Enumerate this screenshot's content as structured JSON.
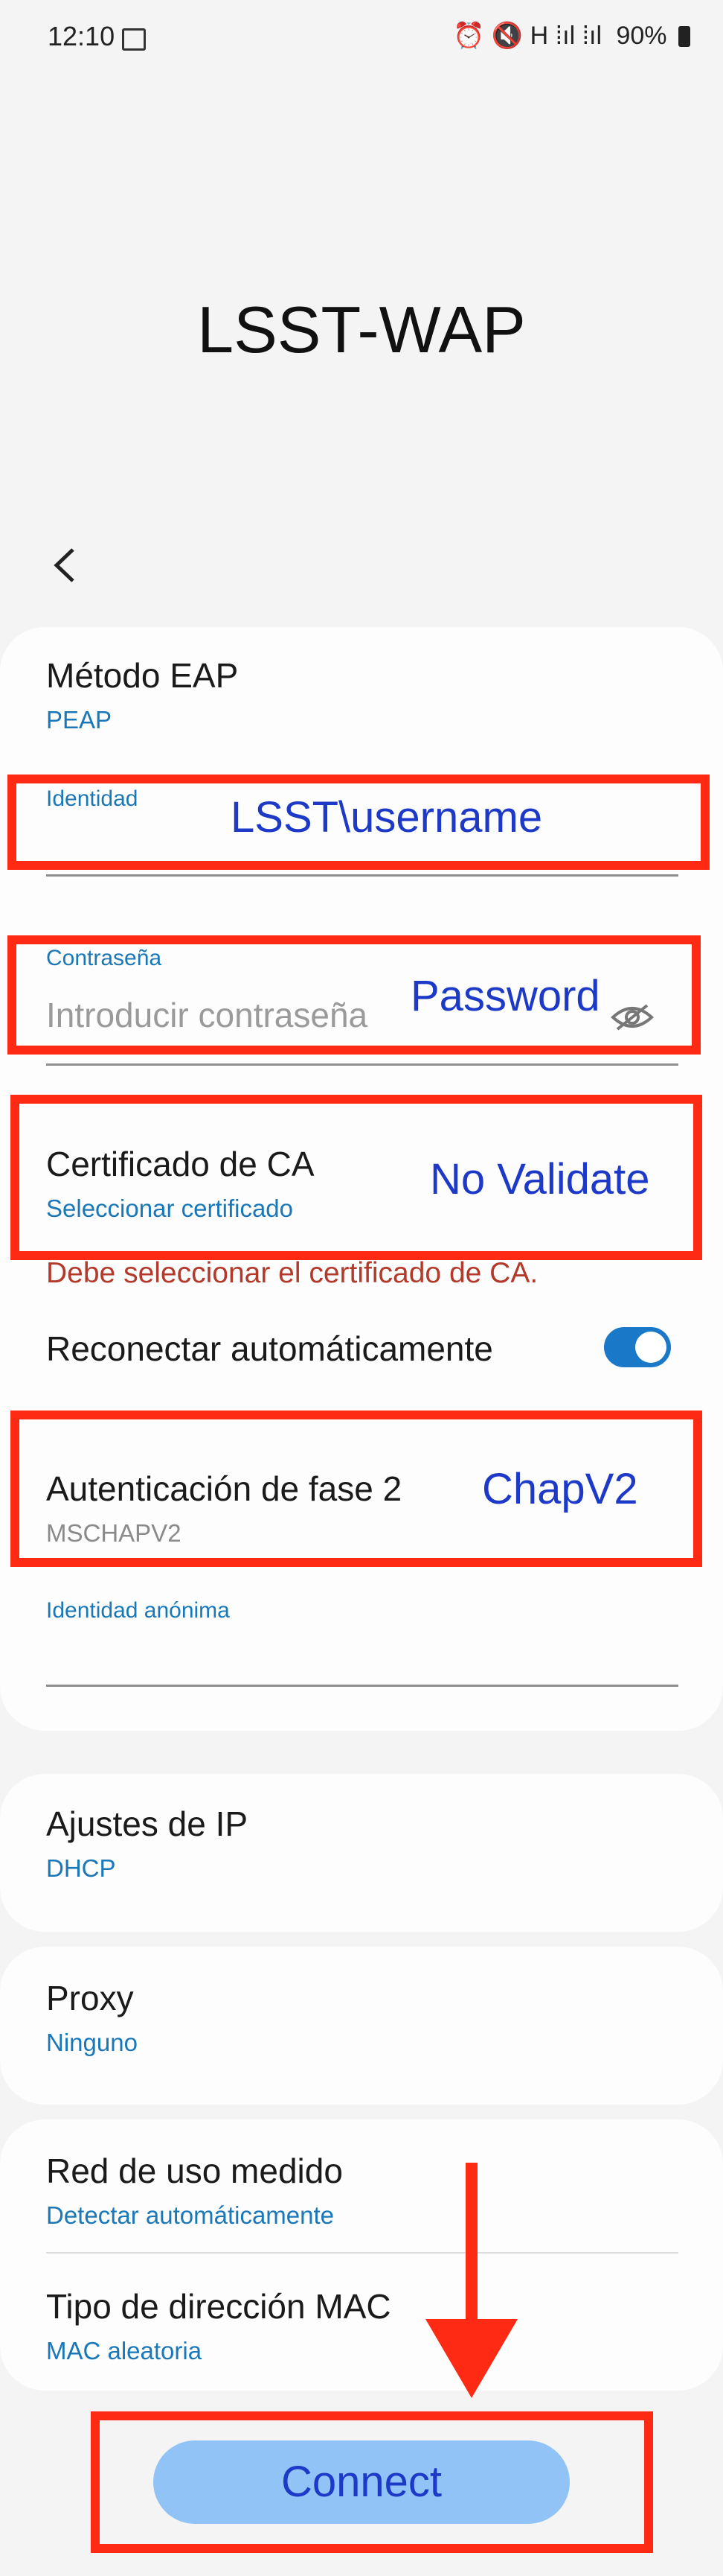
{
  "status_bar": {
    "time": "12:10",
    "battery": "90%",
    "indicators": "⏰ 🔇 H ⁞ıl ⁞ıl"
  },
  "network_name": "LSST-WAP",
  "fields": {
    "eap_method": {
      "title": "Método EAP",
      "value": "PEAP"
    },
    "identity": {
      "label": "Identidad",
      "annotation": "LSST\\username"
    },
    "password": {
      "label": "Contraseña",
      "placeholder": "Introducir contraseña",
      "annotation": "Password"
    },
    "ca_cert": {
      "title": "Certificado de CA",
      "value": "Seleccionar certificado",
      "annotation": "No Validate"
    },
    "error": "Debe seleccionar el certificado de CA.",
    "auto_reconnect": {
      "title": "Reconectar automáticamente",
      "on": true
    },
    "phase2": {
      "title": "Autenticación de fase 2",
      "value": "MSCHAPV2",
      "annotation": "ChapV2"
    },
    "anon_identity": {
      "label": "Identidad anónima"
    }
  },
  "ip_settings": {
    "title": "Ajustes de IP",
    "value": "DHCP"
  },
  "proxy": {
    "title": "Proxy",
    "value": "Ninguno"
  },
  "metered": {
    "title": "Red de uso medido",
    "value": "Detectar automáticamente"
  },
  "mac_type": {
    "title": "Tipo de dirección MAC",
    "value": "MAC aleatoria"
  },
  "connect_label": "Connect",
  "colors": {
    "annotation_red": "#ff2a13",
    "annotation_blue": "#1c39c7",
    "accent": "#1a78b8"
  }
}
